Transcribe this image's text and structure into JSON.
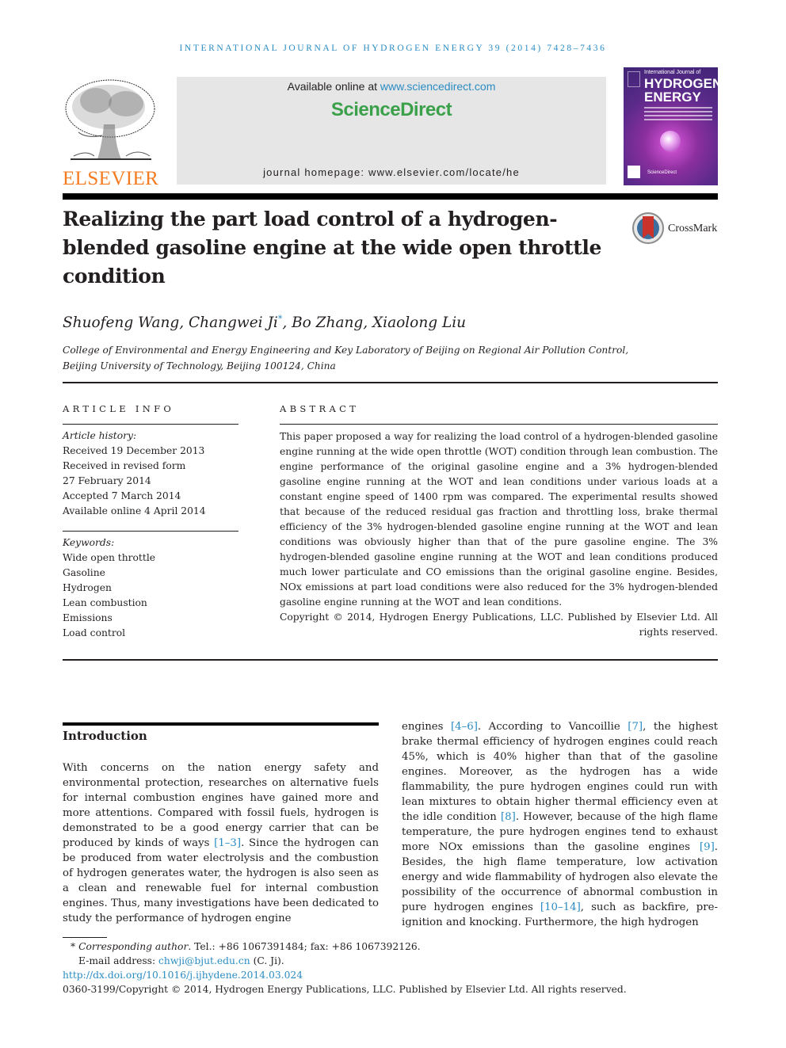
{
  "running_header": "INTERNATIONAL JOURNAL OF HYDROGEN ENERGY 39 (2014) 7428–7436",
  "masthead": {
    "publisher_logo_text": "ELSEVIER",
    "available_online_prefix": "Available online at ",
    "available_online_link": "www.sciencedirect.com",
    "brand": "ScienceDirect",
    "journal_homepage_label": "journal homepage: ",
    "journal_homepage_url": "www.elsevier.com/locate/he",
    "cover": {
      "line1": "International Journal of",
      "line2": "HYDROGEN",
      "line3": "ENERGY",
      "footer": "ScienceDirect"
    },
    "colors": {
      "accent_blue": "#2a8cc3",
      "elsevier_orange": "#f47b20",
      "sciencedirect_green": "#3aa04a",
      "box_gray": "#e6e6e6"
    }
  },
  "article": {
    "title_line1": "Realizing the part load control of a hydrogen-",
    "title_line2": "blended gasoline engine at the wide open throttle",
    "title_line3": "condition",
    "crossmark_label": "CrossMark",
    "authors_before": "Shuofeng Wang, Changwei Ji",
    "corresponding_mark": "*",
    "authors_after": ", Bo Zhang, Xiaolong Liu",
    "affiliation_line1": "College of Environmental and Energy Engineering and Key Laboratory of Beijing on Regional Air Pollution Control,",
    "affiliation_line2": "Beijing University of Technology, Beijing 100124, China"
  },
  "article_info": {
    "heading": "ARTICLE INFO",
    "history_label": "Article history:",
    "history": [
      "Received 19 December 2013",
      "Received in revised form",
      "27 February 2014",
      "Accepted 7 March 2014",
      "Available online 4 April 2014"
    ],
    "keywords_label": "Keywords:",
    "keywords": [
      "Wide open throttle",
      "Gasoline",
      "Hydrogen",
      "Lean combustion",
      "Emissions",
      "Load control"
    ]
  },
  "abstract": {
    "heading": "ABSTRACT",
    "text": "This paper proposed a way for realizing the load control of a hydrogen-blended gasoline engine running at the wide open throttle (WOT) condition through lean combustion. The engine performance of the original gasoline engine and a 3% hydrogen-blended gasoline engine running at the WOT and lean conditions under various loads at a constant engine speed of 1400 rpm was compared. The experimental results showed that because of the reduced residual gas fraction and throttling loss, brake thermal efficiency of the 3% hydrogen-blended gasoline engine running at the WOT and lean conditions was obviously higher than that of the pure gasoline engine. The 3% hydrogen-blended gasoline engine running at the WOT and lean conditions produced much lower particulate and CO emissions than the original gasoline engine. Besides, NOx emissions at part load conditions were also reduced for the 3% hydrogen-blended gasoline engine running at the WOT and lean conditions.",
    "copyright": "Copyright © 2014, Hydrogen Energy Publications, LLC. Published by Elsevier Ltd. All rights reserved."
  },
  "introduction": {
    "heading": "Introduction",
    "left": {
      "p1": "With concerns on the nation energy safety and environmental protection, researches on alternative fuels for internal combustion engines have gained more and more attentions. Compared with fossil fuels, hydrogen is demonstrated to be a good energy carrier that can be produced by kinds of ways ",
      "ref1": "[1–3]",
      "p2": ". Since the hydrogen can be produced from water electrolysis and the combustion of hydrogen generates water, the hydrogen is also seen as a clean and renewable fuel for internal combustion engines. Thus, many investigations have been dedicated to study the performance of hydrogen engine"
    },
    "right": {
      "t1": "engines ",
      "ref1": "[4–6]",
      "t2": ". According to Vancoillie ",
      "ref2": "[7]",
      "t3": ", the highest brake thermal efficiency of hydrogen engines could reach 45%, which is 40% higher than that of the gasoline engines. Moreover, as the hydrogen has a wide flammability, the pure hydrogen engines could run with lean mixtures to obtain higher thermal efficiency even at the idle condition ",
      "ref3": "[8]",
      "t4": ". However, because of the high flame temperature, the pure hydrogen engines tend to exhaust more NOx emissions than the gasoline engines ",
      "ref4": "[9]",
      "t5": ". Besides, the high flame temperature, low activation energy and wide flammability of hydrogen also elevate the possibility of the occurrence of abnormal combustion in pure hydrogen engines ",
      "ref5": "[10–14]",
      "t6": ", such as backfire, pre-ignition and knocking. Furthermore, the high hydrogen"
    }
  },
  "footnotes": {
    "star": "*",
    "corresponding_label": "Corresponding author",
    "contact": ". Tel.: +86 1067391484; fax: +86 1067392126.",
    "email_label": "E-mail address: ",
    "email": "chwji@bjut.edu.cn",
    "email_suffix": " (C. Ji).",
    "doi": "http://dx.doi.org/10.1016/j.ijhydene.2014.03.024",
    "issn_copyright": "0360-3199/Copyright © 2014, Hydrogen Energy Publications, LLC. Published by Elsevier Ltd. All rights reserved."
  }
}
